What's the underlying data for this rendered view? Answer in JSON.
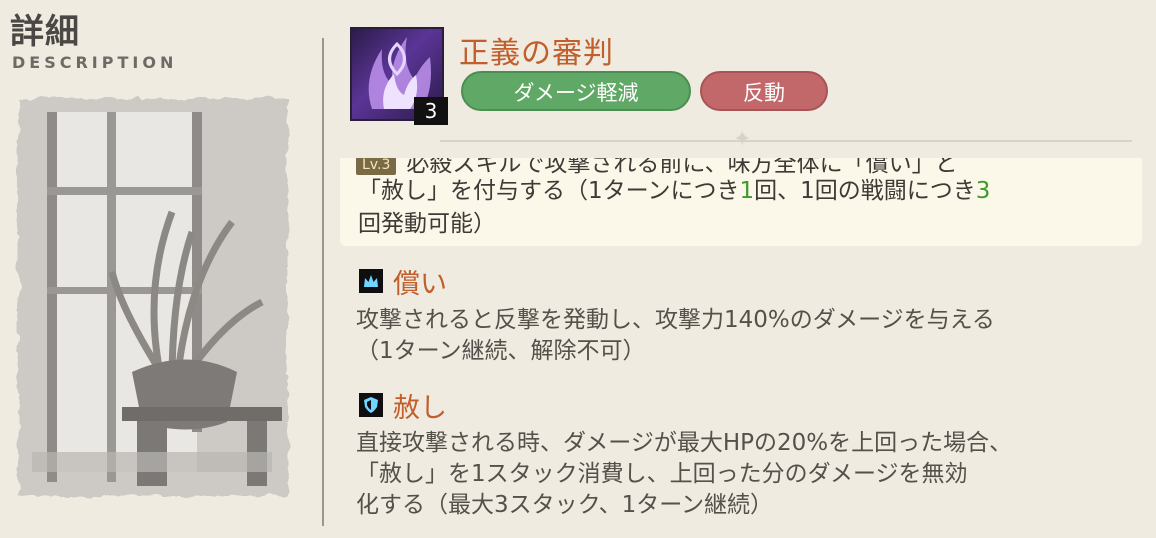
{
  "header": {
    "title": "詳細",
    "subtitle": "DESCRIPTION"
  },
  "skill": {
    "name": "正義の審判",
    "level": "3",
    "icon": "purple-flame-skill-icon",
    "tags": [
      "ダメージ軽減",
      "反動"
    ],
    "colors": {
      "name": "#c15e2c",
      "tag_green": "#5fa865",
      "tag_red": "#c2676a"
    }
  },
  "highlight": {
    "badge": "Lv.3",
    "line1": "必殺スキルで攻撃される前に、味方全体に「償い」と",
    "line2_a": "「赦し」を付与する（1ターンにつき",
    "line2_num1": "1",
    "line2_b": "回、1回の戦闘につき",
    "line2_num2": "3",
    "line3": "回発動可能）",
    "accent_color": "#3e9a2b"
  },
  "buffs": [
    {
      "icon": "crown-buff-icon",
      "name": "償い",
      "desc_line1": "攻撃されると反撃を発動し、攻撃力140%のダメージを与える",
      "desc_line2": "（1ターン継続、解除不可）"
    },
    {
      "icon": "shield-buff-icon",
      "name": "赦し",
      "desc_line1": "直接攻撃される時、ダメージが最大HPの20%を上回った場合、",
      "desc_line2": "「赦し」を1スタック消費し、上回った分のダメージを無効",
      "desc_line3": "化する（最大3スタック、1ターン継続）"
    }
  ]
}
